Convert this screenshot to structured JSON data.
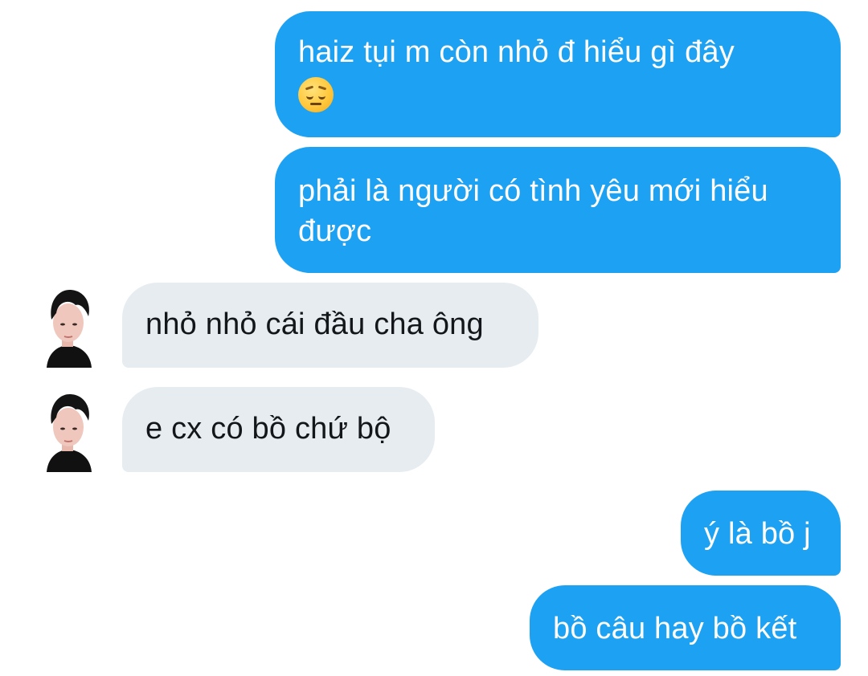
{
  "conversation": {
    "messages": [
      {
        "direction": "outgoing",
        "text": "haiz tụi m còn nhỏ đ hiểu gì đây",
        "emoji": "pensive-face"
      },
      {
        "direction": "outgoing",
        "text": "phải là người có tình yêu mới hiểu được"
      },
      {
        "direction": "incoming",
        "text": "nhỏ nhỏ cái đầu cha ông"
      },
      {
        "direction": "incoming",
        "text": "e cx có bồ chứ bộ"
      },
      {
        "direction": "outgoing",
        "text": "ý là bồ j"
      },
      {
        "direction": "outgoing",
        "text": "bồ câu hay bồ kết"
      }
    ]
  },
  "colors": {
    "outgoing_bubble": "#1da1f2",
    "incoming_bubble": "#e6ecf0",
    "outgoing_text": "#ffffff",
    "incoming_text": "#14171a"
  }
}
